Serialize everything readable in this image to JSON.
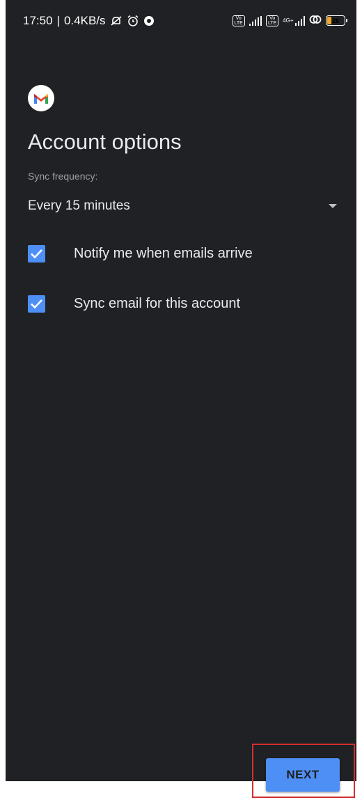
{
  "status_bar": {
    "time": "17:50",
    "separator": "|",
    "speed": "0.4KB/s",
    "battery_level": "28",
    "network_type": "4G+",
    "volte_label": "Vo LTE",
    "icons": [
      "mute-icon",
      "alarm-icon",
      "app-notification-icon",
      "volte-icon",
      "signal-icon",
      "volte-icon",
      "signal-icon",
      "hotspot-icon",
      "battery-icon"
    ]
  },
  "app": {
    "logo": "gmail-logo",
    "title": "Account options"
  },
  "sync": {
    "label": "Sync frequency:",
    "value": "Every 15 minutes"
  },
  "options": [
    {
      "label": "Notify me when emails arrive",
      "checked": true
    },
    {
      "label": "Sync email for this account",
      "checked": true
    }
  ],
  "actions": {
    "next_label": "NEXT"
  },
  "colors": {
    "background": "#202124",
    "accent": "#4d8ff5",
    "highlight": "#d32f2f"
  }
}
